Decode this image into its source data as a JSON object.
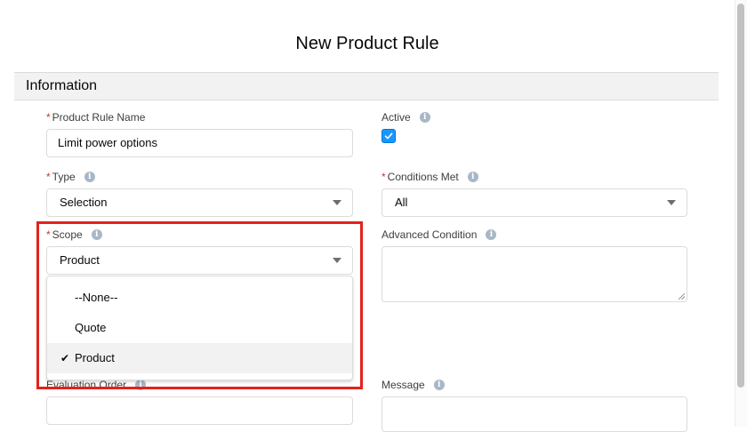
{
  "modal": {
    "title": "New Product Rule"
  },
  "section": {
    "title": "Information"
  },
  "fields": {
    "rule_name": {
      "label": "Product Rule Name",
      "required": "*",
      "value": "Limit power options"
    },
    "active": {
      "label": "Active",
      "checked": true,
      "info_icon": "info-icon"
    },
    "type": {
      "label": "Type",
      "required": "*",
      "value": "Selection",
      "info_icon": "info-icon"
    },
    "conditions_met": {
      "label": "Conditions Met",
      "required": "*",
      "value": "All",
      "info_icon": "info-icon"
    },
    "scope": {
      "label": "Scope",
      "required": "*",
      "value": "Product",
      "info_icon": "info-icon"
    },
    "advanced_condition": {
      "label": "Advanced Condition",
      "value": "",
      "info_icon": "info-icon"
    },
    "evaluation_order": {
      "label": "Evaluation Order",
      "value": "",
      "info_icon": "info-icon"
    },
    "message": {
      "label": "Message",
      "value": "",
      "info_icon": "info-icon"
    }
  },
  "scope_dropdown": {
    "options": [
      {
        "label": "--None--",
        "selected": false
      },
      {
        "label": "Quote",
        "selected": false
      },
      {
        "label": "Product",
        "selected": true
      }
    ],
    "check_icon": "✔"
  },
  "info_glyph": "i",
  "colors": {
    "highlight": "#e3221c",
    "required": "#c23934",
    "checkbox": "#1b96ff",
    "section_bg": "#f3f2f2"
  }
}
